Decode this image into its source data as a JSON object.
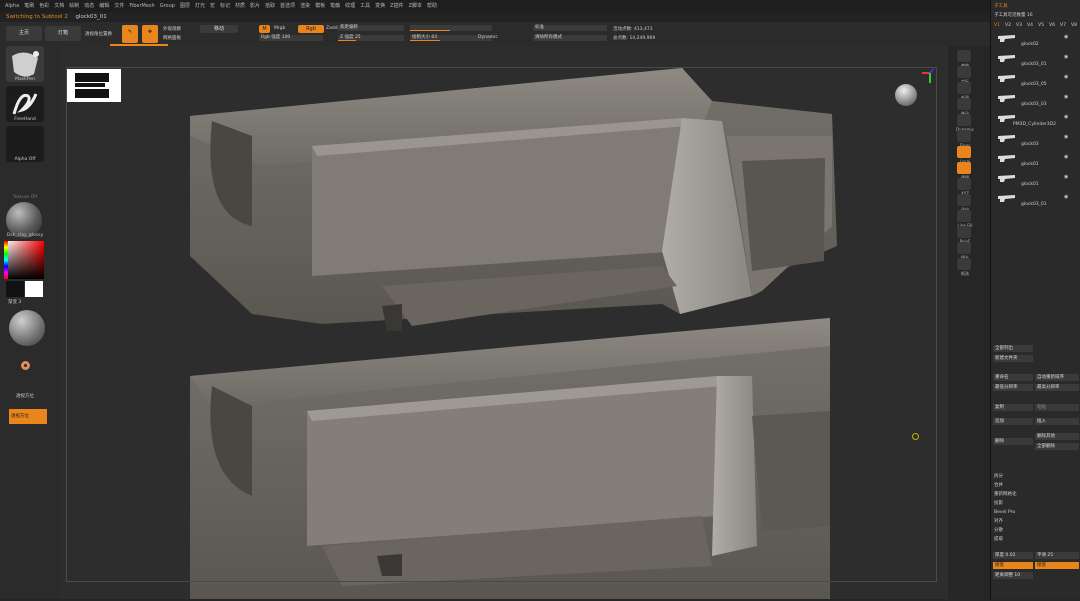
{
  "menu": [
    "Alpha",
    "笔刷",
    "色彩",
    "文档",
    "绘制",
    "动态",
    "编辑",
    "文件",
    "FiberMesh",
    "Group",
    "图层",
    "灯光",
    "宏",
    "标记",
    "材质",
    "影片",
    "拾取",
    "首选项",
    "渲染",
    "模板",
    "笔触",
    "纹理",
    "工具",
    "变换",
    "Z插件",
    "Z脚本",
    "帮助"
  ],
  "status": {
    "message": "Switching to Subtool 2",
    "filename": "glock03_01"
  },
  "toolbar": {
    "home": "主页",
    "light_box": "灯箱",
    "quick_sketch": "透视角位置换",
    "edit": "编辑",
    "draw": "绘制",
    "floor": "外观观察",
    "move": "移动",
    "floor_grid": "网格面板",
    "m_label": "M",
    "mrgb": "Mrgb",
    "rgb": "Rgb",
    "rgb_intensity": "Rgb 强度 100",
    "zadd": "Zadd",
    "focal_shift": "焦距偏移",
    "z_intensity": "Z 强度 25",
    "draw_size": "绘制大小 64",
    "dynamic": "Dynamic",
    "active_points": "活动点数: 413,473",
    "total_points": "总点数: 14,249,969",
    "zsub_label": "标准",
    "zscript": "清除所有模式"
  },
  "left": {
    "brush": "MaskPen",
    "stroke": "FreeHand",
    "alpha": "Alpha Off",
    "texture": "Texture Off",
    "material": "Dsk_clay_glossy",
    "gradient": "渐变 3",
    "switch": "切换颜色",
    "orient": "透视方位",
    "orient_btn": "透视方位"
  },
  "right": [
    "缩放",
    "实际",
    "外观",
    "移动",
    "Dynamic",
    "Floor",
    "Local",
    "透明",
    "XYZ",
    "适应",
    "Line Fill",
    "PolyF",
    "镜头",
    "框选"
  ],
  "panel": {
    "title": "子工具",
    "subtool_count": "子工具可见数量 16",
    "tabs": [
      "V1",
      "V2",
      "V3",
      "V4",
      "V5",
      "V6",
      "V7",
      "V8"
    ],
    "subtools": [
      "glock02",
      "glock03_01",
      "glock03_05",
      "glock03_03",
      "PM3D_Cylinder3D2",
      "glock03",
      "glock01",
      "glock01",
      "glock03_01"
    ],
    "list_all": "全部列出",
    "new_folder": "新建文件夹",
    "rename": "重命名",
    "auto_reorder": "自动重新排序",
    "all_low": "最低分辨率",
    "all_high": "最高分辨率",
    "copy": "复制",
    "paste": "粘贴",
    "append": "追加",
    "insert": "插入",
    "delete": "删除",
    "del_other": "删除其他",
    "del_all": "全部删除",
    "split": "拆分",
    "merge": "合并",
    "remesh": "重新网格化",
    "project": "投影",
    "bevel": "Bevel Pro",
    "align": "对齐",
    "distribute": "分散",
    "extract": "提取",
    "thick": "厚度 0.02",
    "smooth": "平滑 25",
    "accept": "接受",
    "accept_fill": "接受",
    "dist": "距离调整 10"
  },
  "colors": {
    "accent": "#e8861c",
    "bg": "#2d2d2d",
    "panel": "#2a2a2a"
  }
}
